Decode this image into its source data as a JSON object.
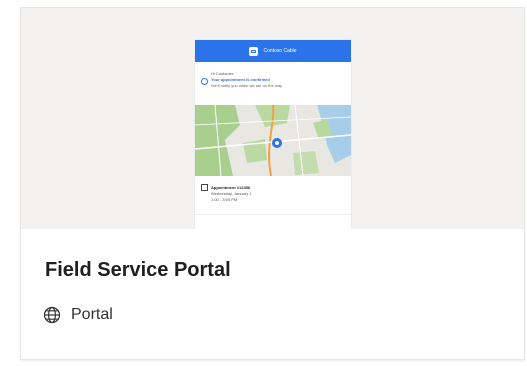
{
  "card": {
    "title": "Field Service Portal",
    "type_label": "Portal",
    "type_icon": "globe-icon"
  },
  "thumbnail": {
    "header_brand": "Contoso Cable",
    "greeting": "Hi Customer,",
    "confirmation": "Your appointment is confirmed",
    "confirmation_sub": "We'll notify you when we are on the way",
    "appointment_title": "Appointment #12456",
    "appointment_date": "Wednesday, January 1",
    "appointment_time": "1:00 - 3:00 PM"
  },
  "colors": {
    "brand_blue": "#2a73e8",
    "thumbnail_background": "#f3f2f1",
    "title_text": "#201f1e"
  }
}
